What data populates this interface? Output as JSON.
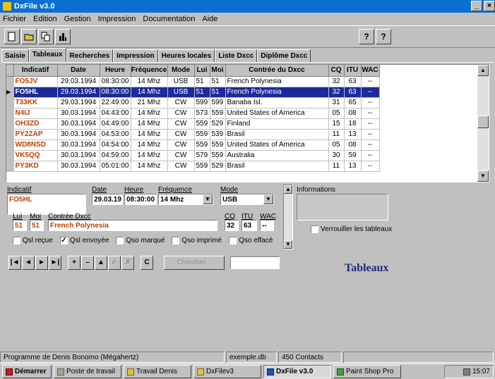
{
  "window": {
    "title": "DxFile v3.0",
    "controls": [
      "_",
      "×"
    ]
  },
  "menu": [
    "Fichier",
    "Edition",
    "Gestion",
    "Impression",
    "Documentation",
    "Aide"
  ],
  "toolbar": {
    "left_buttons": [
      "new-icon",
      "open-icon",
      "copy-icon",
      "stats-icon"
    ],
    "right_buttons": [
      "help-icon",
      "context-help-icon"
    ],
    "help_label": "?",
    "context_help_label": "?"
  },
  "tabs": [
    "Saisie",
    "Tableaux",
    "Recherches",
    "Impression",
    "Heures locales",
    "Liste Dxcc",
    "Diplôme Dxcc"
  ],
  "grid": {
    "columns": [
      "Indicatif",
      "Date",
      "Heure",
      "Fréquence",
      "Mode",
      "Lui",
      "Moi",
      "Contrée du Dxcc",
      "CQ",
      "ITU",
      "WAC"
    ],
    "rows": [
      [
        "FO5JV",
        "29.03.1994",
        "08:30:00",
        "14 Mhz",
        "USB",
        "51",
        "51",
        "French Polynesia",
        "32",
        "63",
        "--"
      ],
      [
        "FO5HL",
        "29.03.1994",
        "08:30:00",
        "14 Mhz",
        "USB",
        "51",
        "51",
        "French Polynesia",
        "32",
        "63",
        "--"
      ],
      [
        "T33KK",
        "29.03.1994",
        "22:49:00",
        "21 Mhz",
        "CW",
        "599",
        "599",
        "Banaba Isl.",
        "31",
        "65",
        "--"
      ],
      [
        "N4IJ",
        "30.03.1994",
        "04:43:00",
        "14 Mhz",
        "CW",
        "573",
        "559",
        "United States of America",
        "05",
        "08",
        "--"
      ],
      [
        "OH3ZD",
        "30.03.1994",
        "04:49:00",
        "14 Mhz",
        "CW",
        "559",
        "529",
        "Finland",
        "15",
        "18",
        "--"
      ],
      [
        "PY2ZAP",
        "30.03.1994",
        "04:53:00",
        "14 Mhz",
        "CW",
        "559",
        "539",
        "Brasil",
        "11",
        "13",
        "--"
      ],
      [
        "WD8NSD",
        "30.03.1994",
        "04:54:00",
        "14 Mhz",
        "CW",
        "559",
        "559",
        "United States of America",
        "05",
        "08",
        "--"
      ],
      [
        "VK5QQ",
        "30.03.1994",
        "04:59:00",
        "14 Mhz",
        "CW",
        "579",
        "559",
        "Australia",
        "30",
        "59",
        "--"
      ],
      [
        "PY3KD",
        "30.03.1994",
        "05:01:00",
        "14 Mhz",
        "CW",
        "559",
        "529",
        "Brasil",
        "11",
        "13",
        "--"
      ]
    ],
    "selected_row": 1,
    "colors": {
      "callsign": "#c04000",
      "selection": "#1c2a9c"
    }
  },
  "form": {
    "indicatif": {
      "label": "Indicatif",
      "value": "FO5HL"
    },
    "date": {
      "label": "Date",
      "value": "29.03.19"
    },
    "heure": {
      "label": "Heure",
      "value": "08:30:00"
    },
    "frequence": {
      "label": "Fréquence",
      "value": "14 Mhz"
    },
    "mode": {
      "label": "Mode",
      "value": "USB"
    },
    "lui": {
      "label": "Lui",
      "value": "51"
    },
    "moi": {
      "label": "Moi",
      "value": "51"
    },
    "contree": {
      "label": "Contrée Dxcc",
      "value": "French Polynesia"
    },
    "cq": {
      "label": "CQ",
      "value": "32"
    },
    "itu": {
      "label": "ITU",
      "value": "63"
    },
    "wac": {
      "label": "WAC",
      "value": "--"
    },
    "checkboxes": [
      {
        "label": "Qsl reçue",
        "checked": false
      },
      {
        "label": "Qsl envoyée",
        "checked": true
      },
      {
        "label": "Qso marqué",
        "checked": false
      },
      {
        "label": "Qso imprimé",
        "checked": false
      },
      {
        "label": "Qso effacé",
        "checked": false
      }
    ],
    "informations_label": "Informations",
    "lock_label": "Verrouiller les tableaux",
    "lock_checked": false
  },
  "navigator": {
    "buttons": [
      "|◄",
      "◄",
      "►",
      "►|",
      "+",
      "–",
      "▲",
      "✓",
      "✗",
      "C"
    ],
    "search_button": "Chercher...",
    "search_value": ""
  },
  "section_title": "Tableaux",
  "status": {
    "author": "Programme de Denis Bonomo (Mégahertz)",
    "file": "exemple.db",
    "count": "450 Contacts"
  },
  "taskbar": {
    "start": "Démarrer",
    "tasks": [
      {
        "label": "Poste de travail",
        "active": false
      },
      {
        "label": "Travail Denis",
        "active": false
      },
      {
        "label": "DxFilev3",
        "active": false
      },
      {
        "label": "DxFile v3.0",
        "active": true
      },
      {
        "label": "Paint Shop Pro",
        "active": false
      }
    ],
    "clock": "15:07"
  }
}
